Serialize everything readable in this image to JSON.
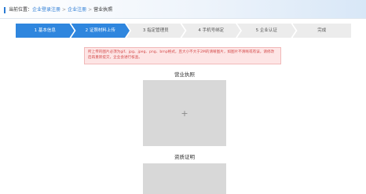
{
  "breadcrumb": {
    "prefix": "当前位置：",
    "items": [
      "企业登录注册",
      "企业注册",
      "营业执照"
    ],
    "separator": ">"
  },
  "steps": [
    {
      "label": "1 基本信息",
      "active": true
    },
    {
      "label": "2 证照材料上传",
      "active": true
    },
    {
      "label": "3 指定管理员",
      "active": false
    },
    {
      "label": "4 手机号绑定",
      "active": false
    },
    {
      "label": "5 企业认证",
      "active": false
    },
    {
      "label": "完成",
      "active": false
    }
  ],
  "alert": {
    "text": "所上传的图片必须为gif、jpg、jpeg、png、bmp格式，且大小不大于2M的清晰图片，如图片不清晰或有误，请修改后再重新提交，企业会进行核查。"
  },
  "uploads": [
    {
      "title": "营业执照",
      "icon": "plus-icon",
      "glyph": "+"
    },
    {
      "title": "资质证明",
      "icon": "plus-icon",
      "glyph": "+"
    }
  ],
  "colors": {
    "accent": "#2f86de",
    "link": "#2b7bd4",
    "alert_bg": "#fde5e5",
    "alert_text": "#d44b4b",
    "upload_bg": "#d8d8d8"
  }
}
